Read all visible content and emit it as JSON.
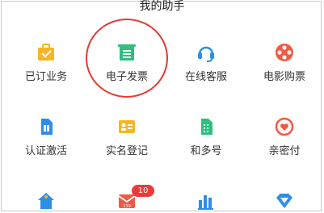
{
  "header": {
    "title": "我的助手"
  },
  "grid": {
    "items": [
      {
        "label": "已订业务",
        "icon": "briefcase-icon"
      },
      {
        "label": "电子发票",
        "icon": "invoice-icon"
      },
      {
        "label": "在线客服",
        "icon": "headset-icon"
      },
      {
        "label": "电影购票",
        "icon": "film-reel-icon"
      },
      {
        "label": "认证激活",
        "icon": "sim-card-icon"
      },
      {
        "label": "实名登记",
        "icon": "id-card-icon"
      },
      {
        "label": "和多号",
        "icon": "phone-number-icon"
      },
      {
        "label": "亲密付",
        "icon": "heart-pay-icon"
      },
      {
        "label": "",
        "icon": "home-icon"
      },
      {
        "label": "",
        "icon": "mail-icon"
      },
      {
        "label": "",
        "icon": "bar-chart-icon"
      },
      {
        "label": "",
        "icon": "diamond-icon"
      }
    ]
  },
  "mail_badge": {
    "count": "10"
  },
  "mail_icon_text": "139",
  "colors": {
    "accent_circle": "#e23a33",
    "badge": "#ec3a3a"
  }
}
